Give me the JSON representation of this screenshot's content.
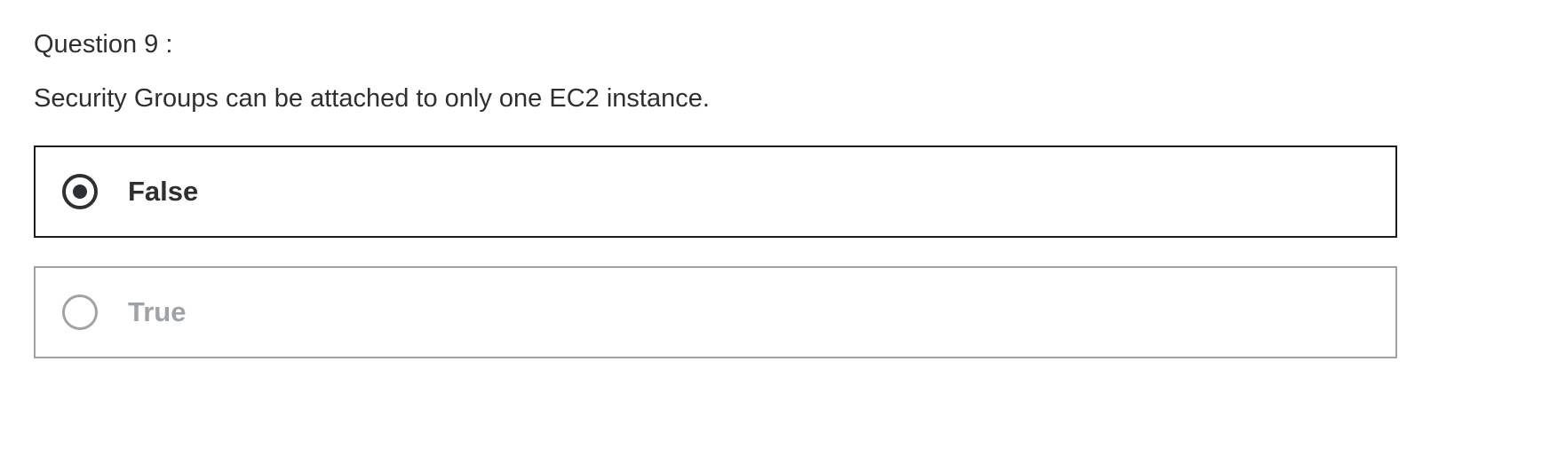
{
  "question": {
    "number_label": "Question 9 :",
    "text": "Security Groups can be attached to only one EC2 instance."
  },
  "options": [
    {
      "label": "False",
      "selected": true
    },
    {
      "label": "True",
      "selected": false
    }
  ],
  "colors": {
    "text": "#2d2f31",
    "selected_border": "#1c1d1f",
    "unselected": "#9da3a7"
  }
}
